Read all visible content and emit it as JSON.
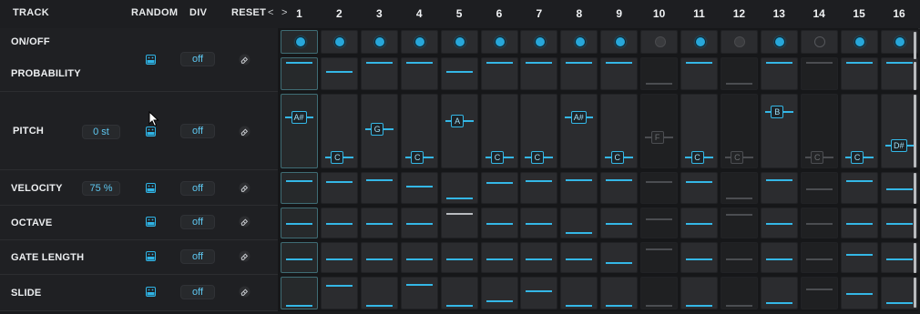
{
  "header": {
    "track": "TRACK",
    "random": "RANDOM",
    "div": "DIV",
    "reset": "RESET",
    "nav_prev": "<",
    "nav_next": ">",
    "steps": [
      "1",
      "2",
      "3",
      "4",
      "5",
      "6",
      "7",
      "8",
      "9",
      "10",
      "11",
      "12",
      "13",
      "14",
      "15",
      "16"
    ]
  },
  "colors": {
    "accent": "#34b7e6",
    "active": "#28a7da",
    "inactive": "#4b4d51",
    "background": "#1a1b1d"
  },
  "rows": {
    "onoff": {
      "label": "ON/OFF"
    },
    "probability": {
      "label": "PROBABILITY",
      "div": "off"
    },
    "pitch": {
      "label": "PITCH",
      "value": "0 st",
      "div": "off"
    },
    "velocity": {
      "label": "VELOCITY",
      "value": "75 %",
      "div": "off"
    },
    "octave": {
      "label": "OCTAVE",
      "div": "off"
    },
    "gate": {
      "label": "GATE LENGTH",
      "div": "off"
    },
    "slide": {
      "label": "SLIDE",
      "div": "off"
    }
  },
  "icons": {
    "random": "dice-image-icon",
    "reset": "eraser-icon"
  },
  "steps": [
    {
      "n": "1",
      "on": "on",
      "prob": 1.0,
      "note": "A#",
      "pitch_level": 0.8,
      "vel": 0.85,
      "oct": 0.5,
      "gate": 0.45,
      "slide": 0.0
    },
    {
      "n": "2",
      "on": "on",
      "prob": 0.6,
      "note": "C",
      "pitch_level": 0.1,
      "vel": 0.8,
      "oct": 0.5,
      "gate": 0.45,
      "slide": 0.85
    },
    {
      "n": "3",
      "on": "on",
      "prob": 1.0,
      "note": "G",
      "pitch_level": 0.6,
      "vel": 0.9,
      "oct": 0.5,
      "gate": 0.45,
      "slide": 0.0
    },
    {
      "n": "4",
      "on": "on",
      "prob": 1.0,
      "note": "C",
      "pitch_level": 0.1,
      "vel": 0.6,
      "oct": 0.5,
      "gate": 0.45,
      "slide": 0.9
    },
    {
      "n": "5",
      "on": "on",
      "prob": 0.6,
      "note": "A",
      "pitch_level": 0.75,
      "vel": 0.1,
      "oct": 0.95,
      "gate": 0.45,
      "slide": 0.0
    },
    {
      "n": "6",
      "on": "on",
      "prob": 1.0,
      "note": "C",
      "pitch_level": 0.1,
      "vel": 0.75,
      "oct": 0.5,
      "gate": 0.45,
      "slide": 0.2
    },
    {
      "n": "7",
      "on": "on",
      "prob": 1.0,
      "note": "C",
      "pitch_level": 0.1,
      "vel": 0.85,
      "oct": 0.5,
      "gate": 0.45,
      "slide": 0.6
    },
    {
      "n": "8",
      "on": "on",
      "prob": 1.0,
      "note": "A#",
      "pitch_level": 0.8,
      "vel": 0.9,
      "oct": 0.1,
      "gate": 0.45,
      "slide": 0.0
    },
    {
      "n": "9",
      "on": "on",
      "prob": 1.0,
      "note": "C",
      "pitch_level": 0.1,
      "vel": 0.9,
      "oct": 0.5,
      "gate": 0.3,
      "slide": 0.0
    },
    {
      "n": "10",
      "on": "off",
      "prob": 0.1,
      "note": "F",
      "pitch_level": 0.45,
      "vel": 0.8,
      "oct": 0.7,
      "gate": 0.9,
      "slide": 0.0
    },
    {
      "n": "11",
      "on": "on",
      "prob": 1.0,
      "note": "C",
      "pitch_level": 0.1,
      "vel": 0.8,
      "oct": 0.5,
      "gate": 0.45,
      "slide": 0.0
    },
    {
      "n": "12",
      "on": "off",
      "prob": 0.1,
      "note": "C",
      "pitch_level": 0.1,
      "vel": 0.1,
      "oct": 0.9,
      "gate": 0.45,
      "slide": 0.0
    },
    {
      "n": "13",
      "on": "on",
      "prob": 1.0,
      "note": "B",
      "pitch_level": 0.9,
      "vel": 0.9,
      "oct": 0.5,
      "gate": 0.45,
      "slide": 0.1
    },
    {
      "n": "14",
      "on": "hollow",
      "prob": 1.0,
      "note": "C",
      "pitch_level": 0.1,
      "vel": 0.5,
      "oct": 0.5,
      "gate": 0.45,
      "slide": 0.7
    },
    {
      "n": "15",
      "on": "on",
      "prob": 1.0,
      "note": "C",
      "pitch_level": 0.1,
      "vel": 0.85,
      "oct": 0.5,
      "gate": 0.65,
      "slide": 0.5
    },
    {
      "n": "16",
      "on": "on",
      "prob": 1.0,
      "note": "D#",
      "pitch_level": 0.3,
      "vel": 0.5,
      "oct": 0.5,
      "gate": 0.45,
      "slide": 0.1
    }
  ]
}
